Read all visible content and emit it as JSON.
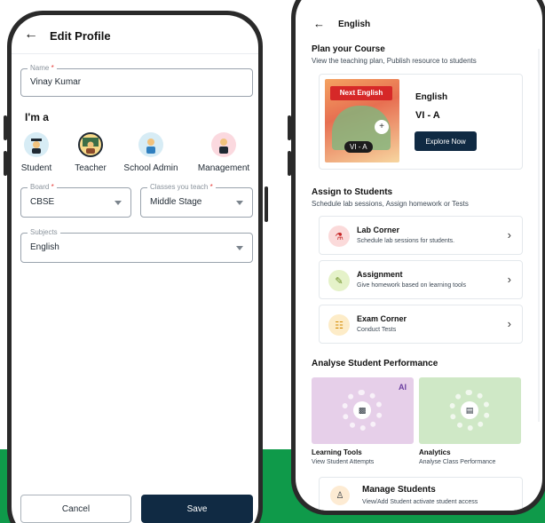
{
  "left": {
    "title": "Edit Profile",
    "name_field": {
      "label": "Name",
      "required": "*",
      "value": "Vinay Kumar"
    },
    "section_role": "I'm a",
    "roles": [
      {
        "label": "Student",
        "icon": "student-icon"
      },
      {
        "label": "Teacher",
        "icon": "teacher-icon",
        "selected": true
      },
      {
        "label": "School Admin",
        "icon": "school-admin-icon"
      },
      {
        "label": "Management",
        "icon": "management-icon"
      }
    ],
    "board_field": {
      "label": "Board",
      "required": "*",
      "value": "CBSE"
    },
    "classes_field": {
      "label": "Classes you teach",
      "required": "*",
      "value": "Middle Stage"
    },
    "subjects_field": {
      "label": "Subjects",
      "value": "English"
    },
    "cancel_label": "Cancel",
    "save_label": "Save"
  },
  "right": {
    "title": "English",
    "plan": {
      "heading": "Plan your Course",
      "sub": "View the teaching plan, Publish resource to students",
      "book_title": "Next English",
      "badge": "VI - A",
      "course_name": "English",
      "course_grade": "VI - A",
      "explore_label": "Explore Now"
    },
    "assign": {
      "heading": "Assign to Students",
      "sub": "Schedule lab sessions, Assign homework or Tests",
      "items": [
        {
          "title": "Lab Corner",
          "sub": "Schedule lab sessions for students.",
          "icon": "lab-corner-icon"
        },
        {
          "title": "Assignment",
          "sub": "Give homework based on learning tools",
          "icon": "assignment-icon"
        },
        {
          "title": "Exam Corner",
          "sub": "Conduct Tests",
          "icon": "exam-corner-icon"
        }
      ]
    },
    "analyse": {
      "heading": "Analyse Student Performance",
      "tiles": [
        {
          "title": "Learning Tools",
          "sub": "View Student Attempts",
          "badge": "AI",
          "icon": "learning-tools-icon"
        },
        {
          "title": "Analytics",
          "sub": "Analyse Class Performance",
          "icon": "analytics-icon"
        }
      ]
    },
    "manage": {
      "title": "Manage Students",
      "sub": "View/Add Student activate student access"
    }
  },
  "colors": {
    "primary_dark": "#102a43",
    "accent_green": "#0f9a4a",
    "required_red": "#e53935",
    "learning_tile": "#e6cfe9",
    "analytics_tile": "#cfe8c6"
  }
}
